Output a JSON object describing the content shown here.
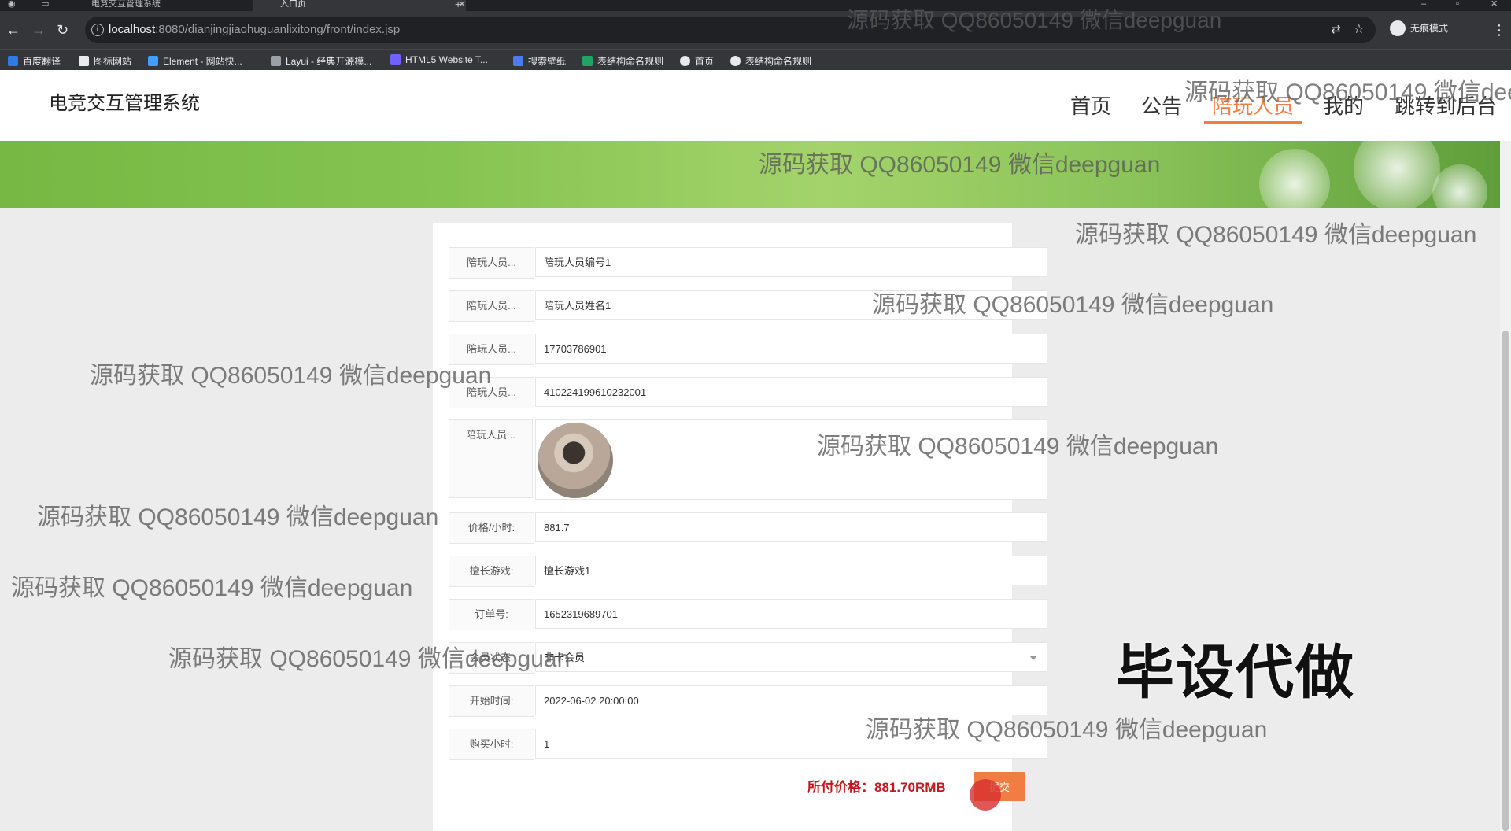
{
  "browser": {
    "tabs": [
      {
        "title": "电竞交互管理系统",
        "active": false
      },
      {
        "title": "入口页",
        "active": true
      }
    ],
    "url_host": "localhost",
    "url_rest": ":8080/dianjingjiaohuguanlixitong/front/index.jsp",
    "incognito_label": "无痕模式",
    "bookmarks": [
      {
        "label": "百度翻译",
        "icon": "baidu-translate-icon",
        "color": "#2d7be5"
      },
      {
        "label": "图标网站",
        "icon": "flag-icon",
        "color": "#e8eaed"
      },
      {
        "label": "Element - 网站快...",
        "icon": "element-icon",
        "color": "#409eff"
      },
      {
        "label": "Layui - 经典开源模...",
        "icon": "layui-icon",
        "color": "#9aa0a6"
      },
      {
        "label": "HTML5 Website T...",
        "icon": "html5-icon",
        "color": "#6f63ff"
      },
      {
        "label": "搜索壁纸",
        "icon": "wallpaper-icon",
        "color": "#4b7bec"
      },
      {
        "label": "表结构命名规则",
        "icon": "sheet-icon",
        "color": "#21a366"
      },
      {
        "label": "首页",
        "icon": "globe-icon",
        "color": "#e8eaed"
      },
      {
        "label": "表结构命名规则",
        "icon": "globe-icon",
        "color": "#e8eaed"
      }
    ]
  },
  "site": {
    "title": "电竞交互管理系统",
    "nav": [
      {
        "label": "首页",
        "active": false
      },
      {
        "label": "公告",
        "active": false
      },
      {
        "label": "陪玩人员",
        "active": true
      },
      {
        "label": "我的",
        "active": false
      },
      {
        "label": "跳转到后台",
        "active": false
      }
    ],
    "accent": "#f27d42"
  },
  "form": {
    "rows": [
      {
        "label": "陪玩人员...",
        "value": "陪玩人员编号1"
      },
      {
        "label": "陪玩人员...",
        "value": "陪玩人员姓名1"
      },
      {
        "label": "陪玩人员...",
        "value": "17703786901"
      },
      {
        "label": "陪玩人员...",
        "value": "410224199610232001"
      },
      {
        "label": "陪玩人员...",
        "value": "",
        "type": "image"
      },
      {
        "label": "价格/小时:",
        "value": "881.7"
      },
      {
        "label": "擅长游戏:",
        "value": "擅长游戏1"
      },
      {
        "label": "订单号:",
        "value": "1652319689701"
      },
      {
        "label": "会员状态:",
        "value": "非卡会员",
        "type": "select"
      },
      {
        "label": "开始时间:",
        "value": "2022-06-02 20:00:00"
      },
      {
        "label": "购买小时:",
        "value": "1"
      }
    ],
    "total_label": "所付价格：881.70RMB",
    "submit_label": "提交"
  },
  "overlay": {
    "watermark": "源码获取 QQ86050149 微信deepguan",
    "stamp": "毕设代做"
  }
}
